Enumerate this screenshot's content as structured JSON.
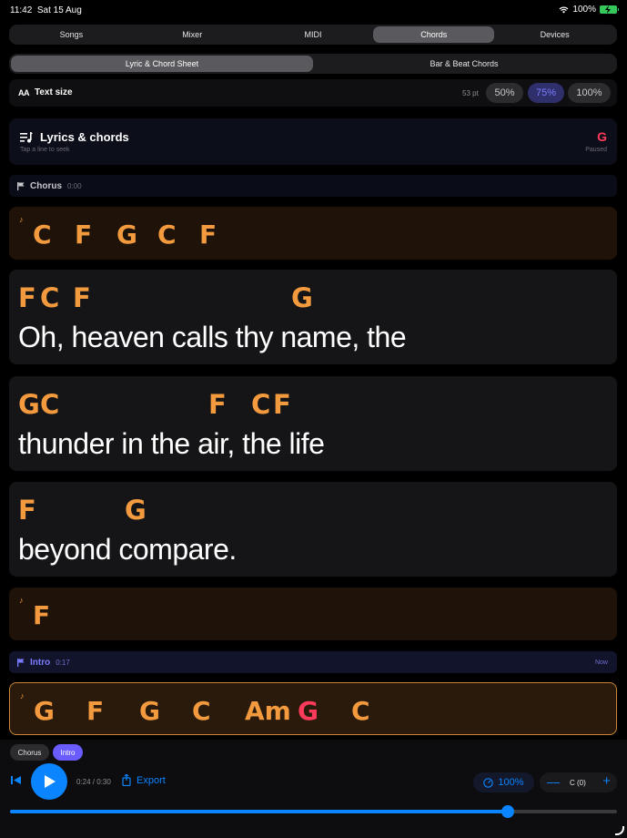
{
  "status": {
    "time": "11:42",
    "date": "Sat 15 Aug",
    "battery": "100%"
  },
  "tabs": [
    "Songs",
    "Mixer",
    "MIDI",
    "Chords",
    "Devices"
  ],
  "subtabs": [
    "Lyric & Chord Sheet",
    "Bar & Beat Chords"
  ],
  "text_size": {
    "icon": "AA",
    "label": "Text size",
    "pt": "53 pt",
    "options": [
      "50%",
      "75%",
      "100%"
    ]
  },
  "lyrics_card": {
    "title": "Lyrics & chords",
    "subtitle": "Tap a line to seek",
    "key": "G",
    "state": "Paused"
  },
  "sections": {
    "chorus": {
      "name": "Chorus",
      "time": "0:00"
    },
    "intro": {
      "name": "Intro",
      "time": "0:17",
      "badge": "Now"
    }
  },
  "chord_rows": {
    "row1": [
      "C",
      "F",
      "G",
      "C",
      "F"
    ],
    "row2": [
      "F"
    ],
    "row3": [
      "G",
      "F",
      "G",
      "C",
      "Am",
      "G",
      "C"
    ]
  },
  "lyric_lines": [
    {
      "chords": [
        "F",
        "C",
        "F",
        "G"
      ],
      "text": "Oh, heaven calls thy name, the"
    },
    {
      "chords": [
        "G",
        "C",
        "F",
        "C",
        "F"
      ],
      "text": "thunder in the air, the life"
    },
    {
      "chords": [
        "F",
        "G"
      ],
      "text": "beyond compare."
    }
  ],
  "footer": {
    "chips": [
      "Chorus",
      "Intro"
    ],
    "position": "0:24 / 0:30",
    "export": "Export",
    "tempo": "100%",
    "key_value": "C (0)",
    "progress": 0.82
  },
  "colors": {
    "accent": "#0a84ff",
    "chord": "#f39a3e",
    "key": "#ff3b5c",
    "active_pill": "#7d7dff"
  }
}
